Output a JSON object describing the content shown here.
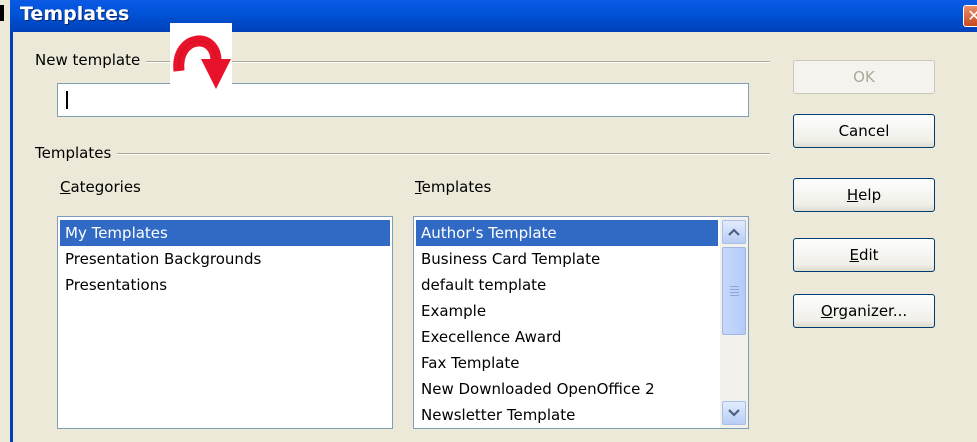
{
  "window": {
    "title": "Templates",
    "close_glyph": "✕"
  },
  "new_template": {
    "group_label": "New template",
    "input_value": ""
  },
  "templates_group": {
    "group_label": "Templates",
    "categories_label_mnemonic": "C",
    "categories_label_rest": "ategories",
    "templates_label_mnemonic": "T",
    "templates_label_rest": "emplates",
    "categories": [
      {
        "label": "My Templates",
        "selected": true
      },
      {
        "label": "Presentation Backgrounds",
        "selected": false
      },
      {
        "label": "Presentations",
        "selected": false
      }
    ],
    "templates": [
      {
        "label": "Author's Template",
        "selected": true
      },
      {
        "label": "Business Card Template",
        "selected": false
      },
      {
        "label": "default template",
        "selected": false
      },
      {
        "label": "Example",
        "selected": false
      },
      {
        "label": "Execellence Award",
        "selected": false
      },
      {
        "label": "Fax Template",
        "selected": false
      },
      {
        "label": "New Downloaded OpenOffice 2",
        "selected": false
      },
      {
        "label": "Newsletter Template",
        "selected": false
      }
    ]
  },
  "buttons": {
    "ok": "OK",
    "cancel": "Cancel",
    "help_mnemonic": "H",
    "help_rest": "elp",
    "edit_mnemonic": "E",
    "edit_rest": "dit",
    "organizer_mnemonic": "O",
    "organizer_rest": "rganizer..."
  },
  "icons": {
    "annotation": "curved-arrow-icon",
    "scroll_up": "scroll-up-icon",
    "scroll_down": "scroll-down-icon"
  },
  "colors": {
    "titlebar": "#0052d6",
    "selection": "#316ac5",
    "arrow": "#e8132a",
    "dialog_bg": "#ece9d8"
  }
}
